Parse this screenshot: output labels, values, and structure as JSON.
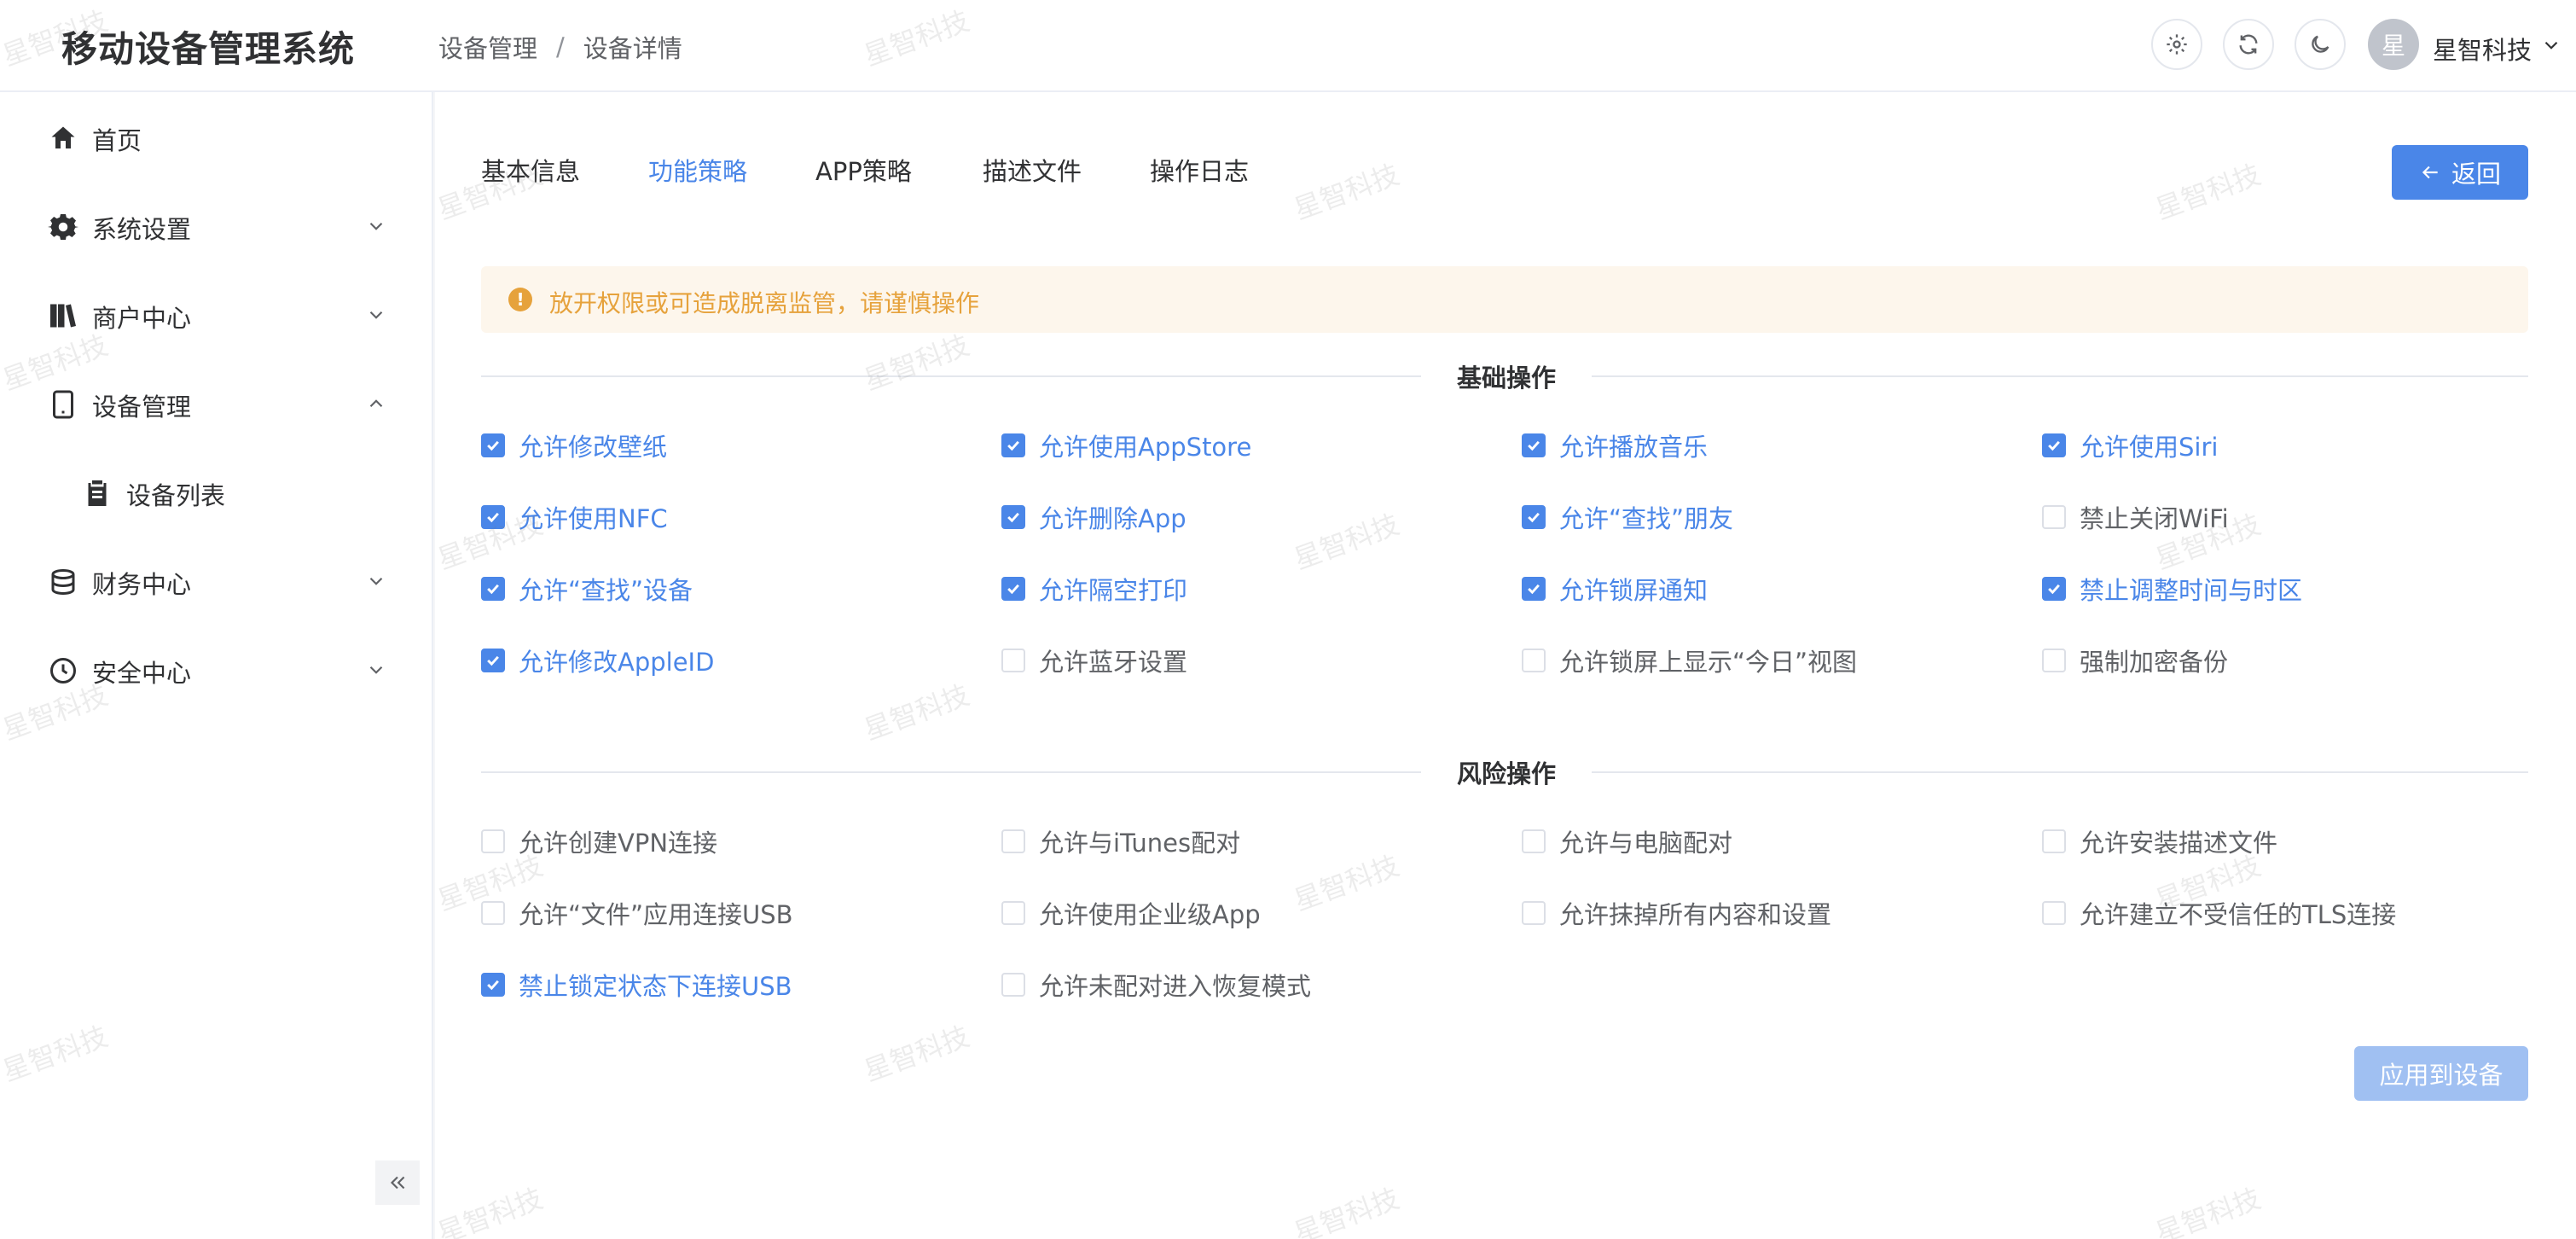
{
  "header": {
    "app_title": "移动设备管理系统",
    "breadcrumb": [
      "设备管理",
      "设备详情"
    ],
    "breadcrumb_sep": "/",
    "user_avatar_text": "星",
    "user_name": "星智科技"
  },
  "sidebar": {
    "items": [
      {
        "label": "首页",
        "icon": "home-icon"
      },
      {
        "label": "系统设置",
        "icon": "gear-icon"
      },
      {
        "label": "商户中心",
        "icon": "books-icon"
      },
      {
        "label": "设备管理",
        "icon": "mobile-icon"
      },
      {
        "label": "设备列表",
        "icon": "clipboard-icon"
      },
      {
        "label": "财务中心",
        "icon": "coins-icon"
      },
      {
        "label": "安全中心",
        "icon": "clock-icon"
      }
    ]
  },
  "tabs": [
    {
      "label": "基本信息",
      "active": false
    },
    {
      "label": "功能策略",
      "active": true
    },
    {
      "label": "APP策略",
      "active": false
    },
    {
      "label": "描述文件",
      "active": false
    },
    {
      "label": "操作日志",
      "active": false
    }
  ],
  "back_button": "返回",
  "alert_text": "放开权限或可造成脱离监管，请谨慎操作",
  "sections": [
    {
      "title": "基础操作",
      "options": [
        {
          "label": "允许修改壁纸",
          "checked": true
        },
        {
          "label": "允许使用AppStore",
          "checked": true
        },
        {
          "label": "允许播放音乐",
          "checked": true
        },
        {
          "label": "允许使用Siri",
          "checked": true
        },
        {
          "label": "允许使用NFC",
          "checked": true
        },
        {
          "label": "允许删除App",
          "checked": true
        },
        {
          "label": "允许“查找”朋友",
          "checked": true
        },
        {
          "label": "禁止关闭WiFi",
          "checked": false
        },
        {
          "label": "允许“查找”设备",
          "checked": true
        },
        {
          "label": "允许隔空打印",
          "checked": true
        },
        {
          "label": "允许锁屏通知",
          "checked": true
        },
        {
          "label": "禁止调整时间与时区",
          "checked": true
        },
        {
          "label": "允许修改AppleID",
          "checked": true
        },
        {
          "label": "允许蓝牙设置",
          "checked": false
        },
        {
          "label": "允许锁屏上显示“今日”视图",
          "checked": false
        },
        {
          "label": "强制加密备份",
          "checked": false
        }
      ]
    },
    {
      "title": "风险操作",
      "options": [
        {
          "label": "允许创建VPN连接",
          "checked": false
        },
        {
          "label": "允许与iTunes配对",
          "checked": false
        },
        {
          "label": "允许与电脑配对",
          "checked": false
        },
        {
          "label": "允许安装描述文件",
          "checked": false
        },
        {
          "label": "允许“文件”应用连接USB",
          "checked": false
        },
        {
          "label": "允许使用企业级App",
          "checked": false
        },
        {
          "label": "允许抹掉所有内容和设置",
          "checked": false
        },
        {
          "label": "允许建立不受信任的TLS连接",
          "checked": false
        },
        {
          "label": "禁止锁定状态下连接USB",
          "checked": true
        },
        {
          "label": "允许未配对进入恢复模式",
          "checked": false
        }
      ]
    }
  ],
  "apply_button": "应用到设备",
  "watermark_text": "星智科技",
  "colors": {
    "primary": "#4a86e8",
    "warning": "#e6a23c",
    "warning_bg": "#fdf6ec",
    "disabled_primary": "#a0c0f2"
  }
}
